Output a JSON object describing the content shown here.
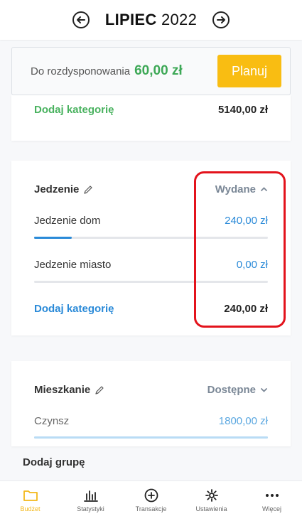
{
  "header": {
    "month": "LIPIEC",
    "year": "2022"
  },
  "budget": {
    "label": "Do rozdysponowania",
    "amount": "60,00 zł",
    "plan_button": "Planuj"
  },
  "top_card": {
    "add_category": "Dodaj kategorię",
    "total": "5140,00 zł"
  },
  "food_group": {
    "title": "Jedzenie",
    "toggle_label": "Wydane",
    "categories": [
      {
        "name": "Jedzenie dom",
        "amount": "240,00 zł",
        "progress": 0.16
      },
      {
        "name": "Jedzenie miasto",
        "amount": "0,00 zł",
        "progress": 0
      }
    ],
    "add_category": "Dodaj kategorię",
    "total": "240,00 zł"
  },
  "housing_group": {
    "title": "Mieszkanie",
    "toggle_label": "Dostępne",
    "categories": [
      {
        "name": "Czynsz",
        "amount": "1800,00 zł",
        "progress": 1
      }
    ]
  },
  "add_group": "Dodaj grupę",
  "bottom_nav": [
    {
      "label": "Budżet",
      "icon": "folder-icon",
      "active": true
    },
    {
      "label": "Statystyki",
      "icon": "bar-chart-icon",
      "active": false
    },
    {
      "label": "Transakcje",
      "icon": "plus-circle-icon",
      "active": false
    },
    {
      "label": "Ustawienia",
      "icon": "gear-icon",
      "active": false
    },
    {
      "label": "Więcej",
      "icon": "more-icon",
      "active": false
    }
  ],
  "colors": {
    "accent_yellow": "#f9bd12",
    "green": "#49b25f",
    "blue": "#2a8ad8",
    "highlight_red": "#e3131c"
  }
}
